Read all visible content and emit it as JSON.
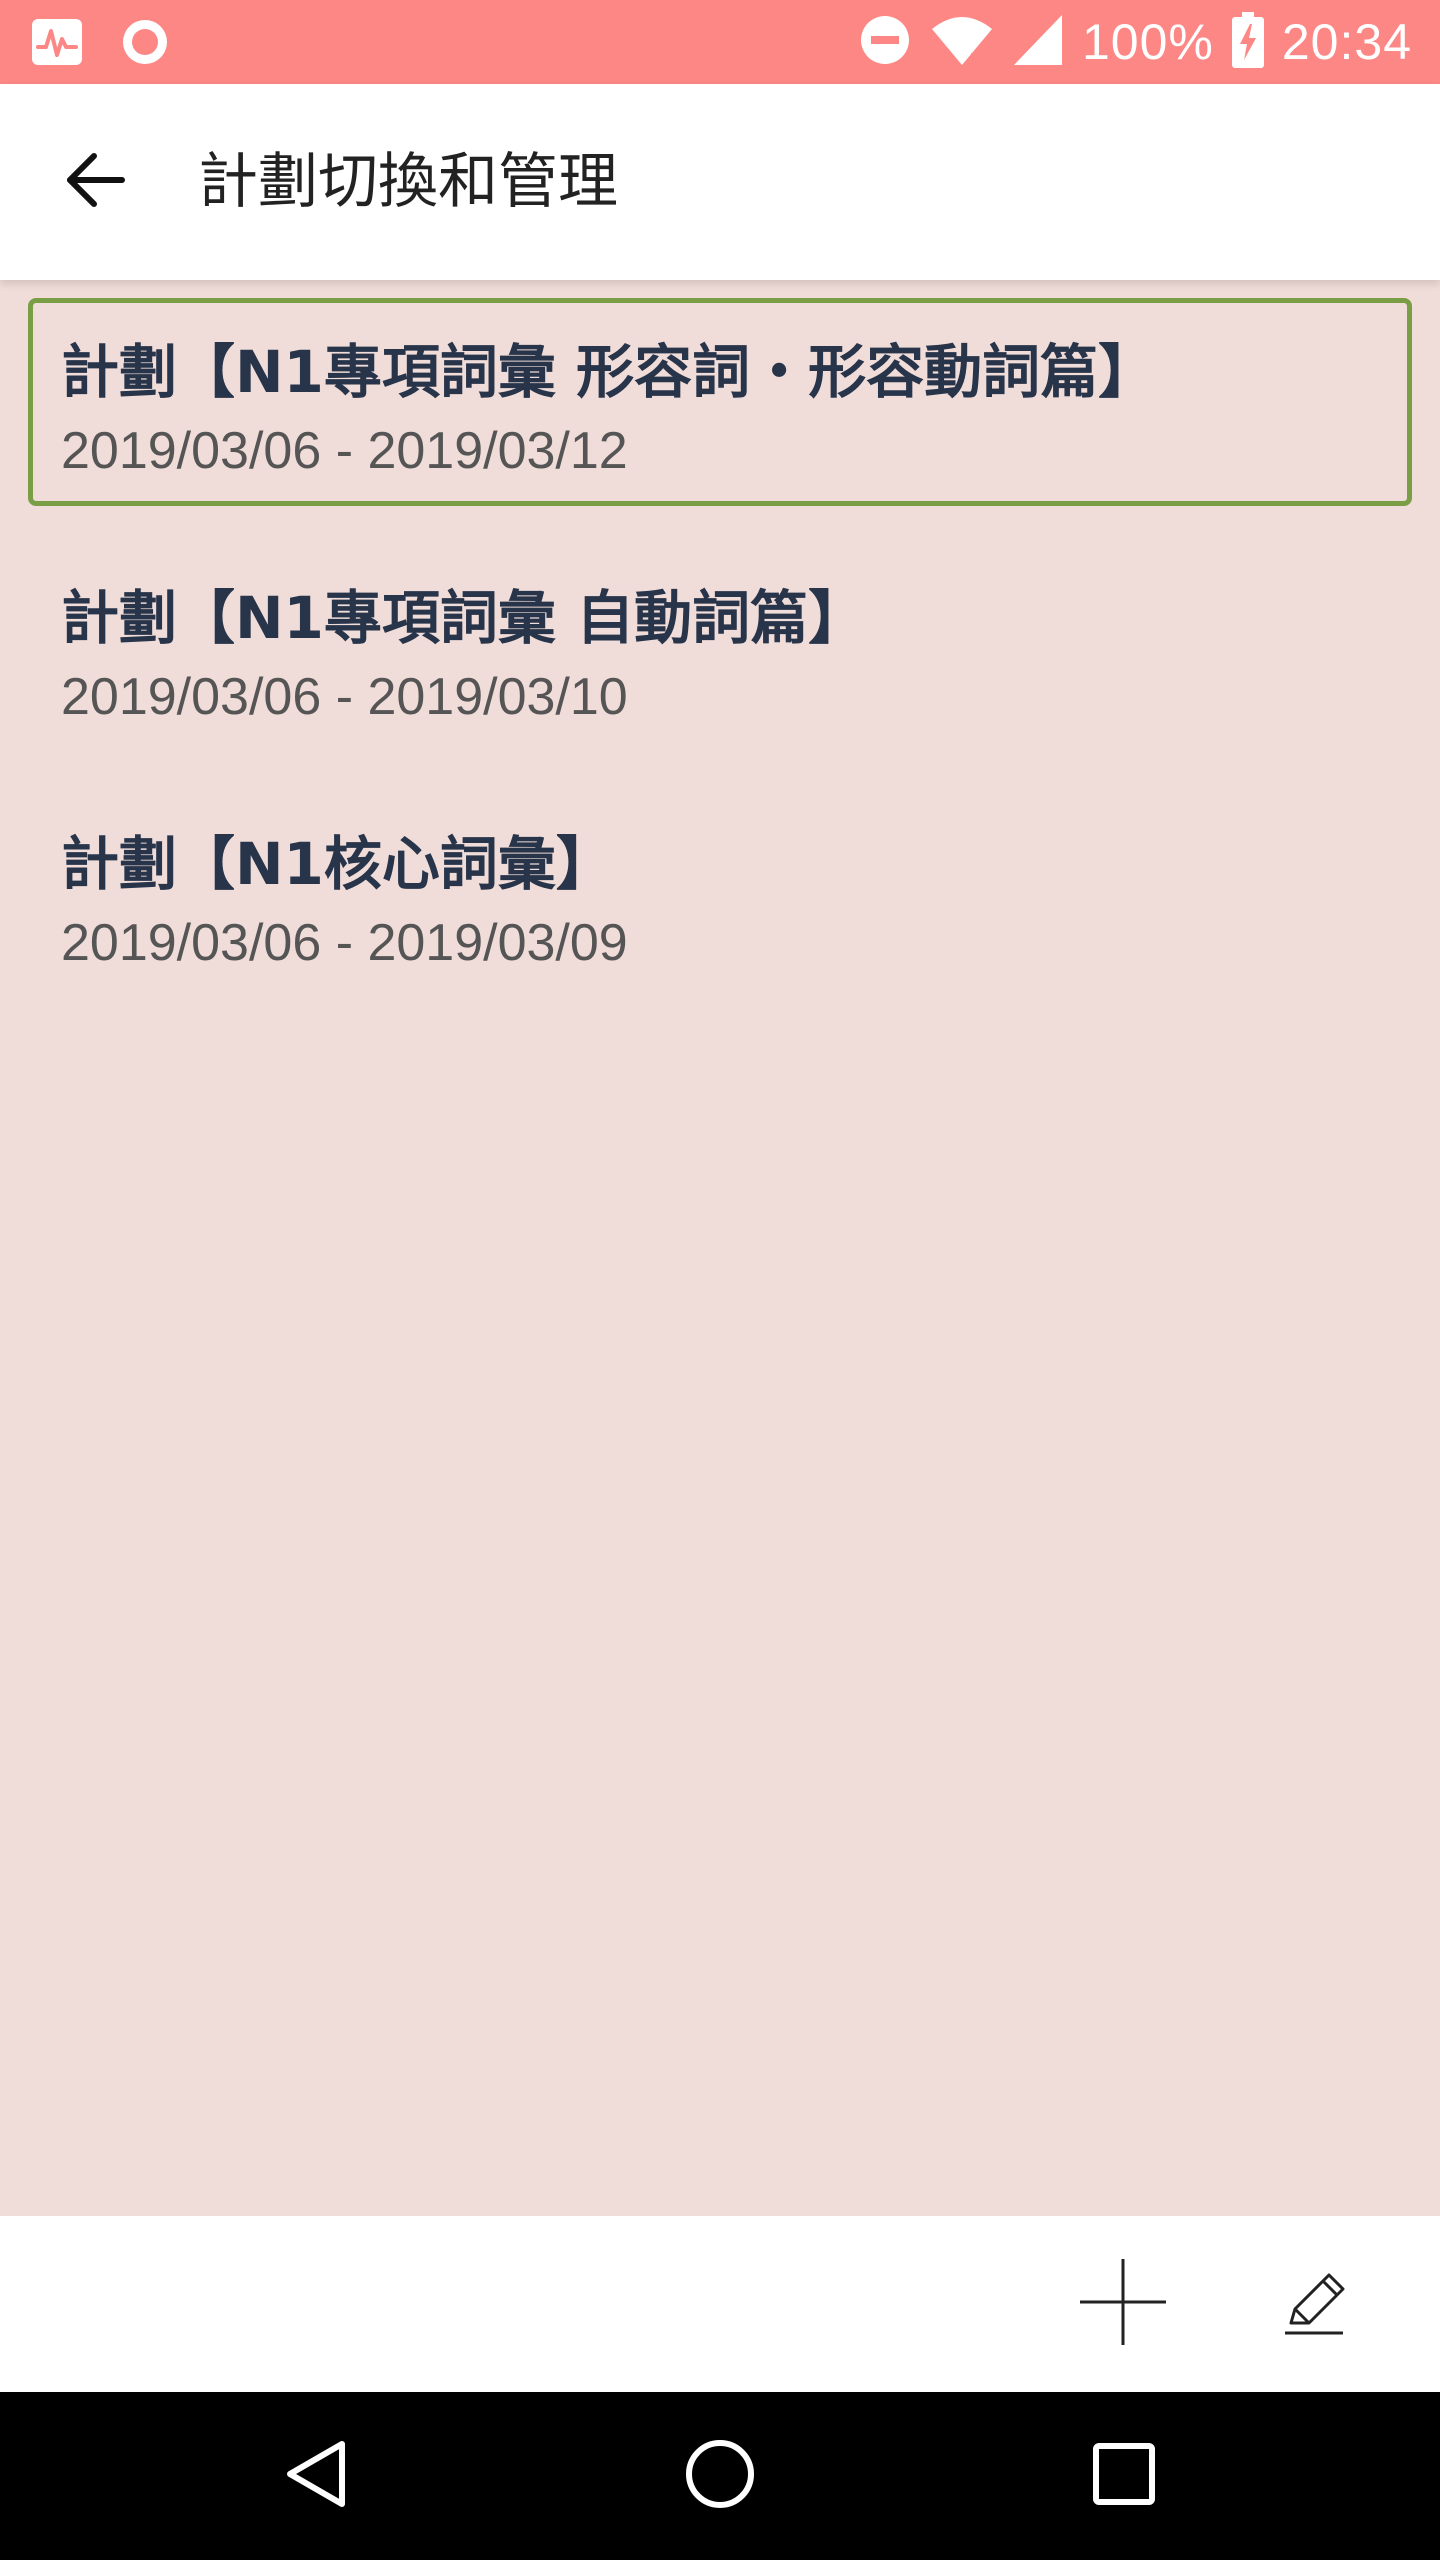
{
  "status_bar": {
    "battery": "100%",
    "time": "20:34",
    "icons": [
      "activity-icon",
      "record-icon",
      "do-not-disturb-icon",
      "wifi-icon",
      "signal-icon",
      "battery-charging-icon"
    ]
  },
  "app_bar": {
    "title": "計劃切換和管理",
    "back_icon": "arrow-left-icon"
  },
  "plans": [
    {
      "title": "計劃【N1專項詞彙 形容詞・形容動詞篇】",
      "dates": "2019/03/06 - 2019/03/12",
      "selected": true
    },
    {
      "title": "計劃【N1專項詞彙 自動詞篇】",
      "dates": "2019/03/06 - 2019/03/10",
      "selected": false
    },
    {
      "title": "計劃【N1核心詞彙】",
      "dates": "2019/03/06 - 2019/03/09",
      "selected": false
    }
  ],
  "toolbar": {
    "icons": [
      "plus-icon",
      "pencil-icon"
    ]
  },
  "nav_bar": {
    "icons": [
      "back-triangle-icon",
      "home-circle-icon",
      "recents-square-icon"
    ]
  },
  "colors": {
    "status_bar": "#FC8785",
    "background": "#F0DCD8",
    "selected_border": "#7A9E45",
    "title_text": "#27344A",
    "date_text": "#555555"
  }
}
